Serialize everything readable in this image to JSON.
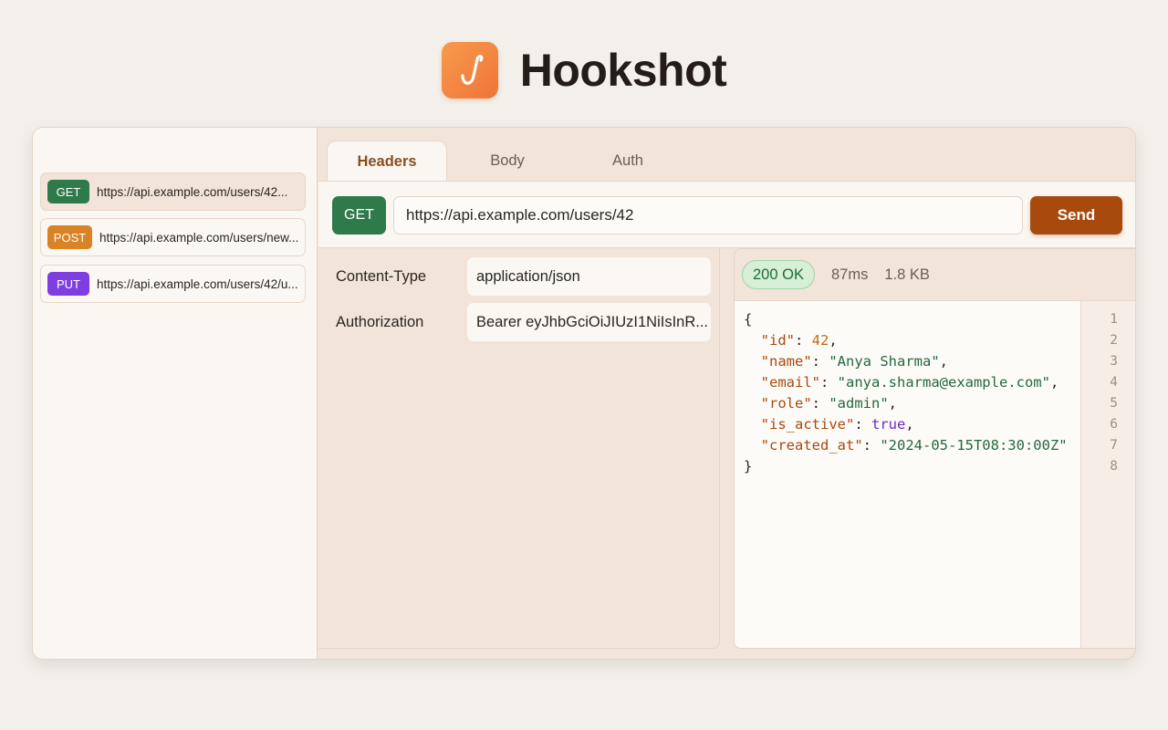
{
  "app": {
    "title": "Hookshot",
    "logo_icon": "hook-icon",
    "accent": "#f0743a"
  },
  "colors": {
    "get": "#2f7a4a",
    "post": "#d98324",
    "put": "#7f3fe0",
    "send": "#a8490e"
  },
  "sidebar": {
    "history": [
      {
        "method": "GET",
        "url": "https://api.example.com/users/42...",
        "selected": true
      },
      {
        "method": "POST",
        "url": "https://api.example.com/users/new...",
        "selected": false
      },
      {
        "method": "PUT",
        "url": "https://api.example.com/users/42/u...",
        "selected": false
      }
    ]
  },
  "tabs": [
    {
      "label": "Headers",
      "active": true
    },
    {
      "label": "Body",
      "active": false
    },
    {
      "label": "Auth",
      "active": false
    }
  ],
  "request": {
    "method": "GET",
    "url": "https://api.example.com/users/42",
    "send_label": "Send"
  },
  "headers": [
    {
      "key": "Content-Type",
      "value": "application/json"
    },
    {
      "key": "Authorization",
      "value": "Bearer eyJhbGciOiJIUzI1NiIsInR..."
    }
  ],
  "response": {
    "status": "200 OK",
    "time": "87ms",
    "size": "1.8 KB",
    "body_lines": [
      "{",
      "\"id\": 42,",
      "\"name\": \"Anya Sharma\",",
      "\"email\": \"anya.sharma@example.com\",",
      "\"role\": \"admin\",",
      "\"is_active\": true,",
      "\"created_at\": \"2024-05-15T08:30:00Z\"",
      "}"
    ],
    "line_numbers": [
      "1",
      "2",
      "3",
      "4",
      "5",
      "6",
      "7",
      "8"
    ],
    "fields": {
      "id_key": "\"id\"",
      "id_val": "42",
      "name_key": "\"name\"",
      "name_val": "\"Anya Sharma\"",
      "email_key": "\"email\"",
      "email_val": "\"anya.sharma@example.com\"",
      "role_key": "\"role\"",
      "role_val": "\"admin\"",
      "active_key": "\"is_active\"",
      "active_val": "true",
      "created_key": "\"created_at\"",
      "created_val": "\"2024-05-15T08:30:00Z\""
    }
  }
}
